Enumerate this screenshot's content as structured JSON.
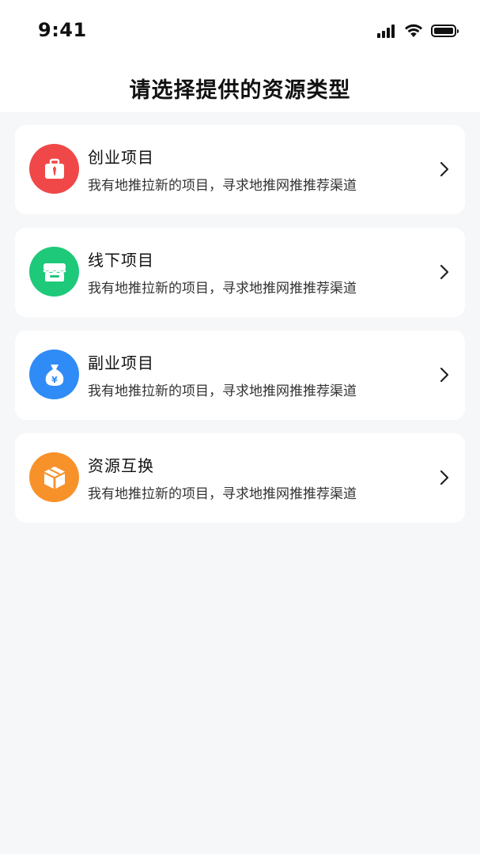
{
  "status_bar": {
    "time": "9:41"
  },
  "header": {
    "title": "请选择提供的资源类型"
  },
  "resource_types": [
    {
      "title": "创业项目",
      "description": "我有地推拉新的项目，寻求地推网推推荐渠道",
      "icon": "briefcase-icon",
      "color": "#f04848"
    },
    {
      "title": "线下项目",
      "description": "我有地推拉新的项目，寻求地推网推推荐渠道",
      "icon": "store-icon",
      "color": "#1ec97a"
    },
    {
      "title": "副业项目",
      "description": "我有地推拉新的项目，寻求地推网推推荐渠道",
      "icon": "money-bag-icon",
      "color": "#2f8bf5"
    },
    {
      "title": "资源互换",
      "description": "我有地推拉新的项目，寻求地推网推推荐渠道",
      "icon": "box-icon",
      "color": "#f7922a"
    }
  ]
}
